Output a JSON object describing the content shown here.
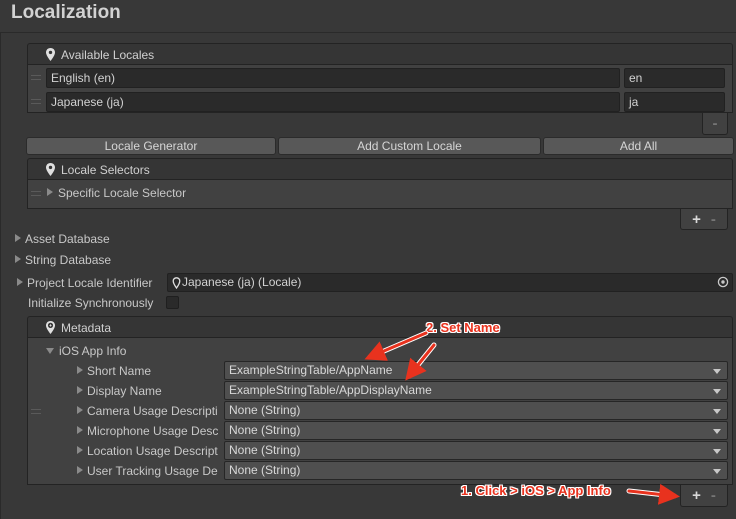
{
  "header": {
    "title": "Localization"
  },
  "available_locales": {
    "title": "Available Locales",
    "rows": [
      {
        "name": "English (en)",
        "code": "en"
      },
      {
        "name": "Japanese (ja)",
        "code": "ja"
      }
    ],
    "remove_label": "-"
  },
  "buttons": {
    "locale_generator": "Locale Generator",
    "add_custom_locale": "Add Custom Locale",
    "add_all": "Add All"
  },
  "locale_selectors": {
    "title": "Locale Selectors",
    "items": [
      {
        "label": "Specific Locale Selector"
      }
    ],
    "add_label": "+",
    "remove_label": "-"
  },
  "foldouts": {
    "asset_database": "Asset Database",
    "string_database": "String Database"
  },
  "project_locale": {
    "label": "Project Locale Identifier",
    "value": "Japanese (ja) (Locale)"
  },
  "initialize_sync": {
    "label": "Initialize Synchronously",
    "checked": false
  },
  "metadata": {
    "title": "Metadata",
    "ios_app_info": {
      "label": "iOS App Info",
      "rows": [
        {
          "label": "Short Name",
          "value": "ExampleStringTable/AppName"
        },
        {
          "label": "Display Name",
          "value": "ExampleStringTable/AppDisplayName"
        },
        {
          "label": "Camera Usage Descripti",
          "value": "None (String)"
        },
        {
          "label": "Microphone Usage Desc",
          "value": "None (String)"
        },
        {
          "label": "Location Usage Descript",
          "value": "None (String)"
        },
        {
          "label": "User Tracking Usage De",
          "value": "None (String)"
        }
      ]
    },
    "add_label": "+",
    "remove_label": "-"
  },
  "annotations": {
    "set_name": "2. Set Name",
    "click_ios": "1. Click > iOS > App Info",
    "color": "#e8321e"
  }
}
